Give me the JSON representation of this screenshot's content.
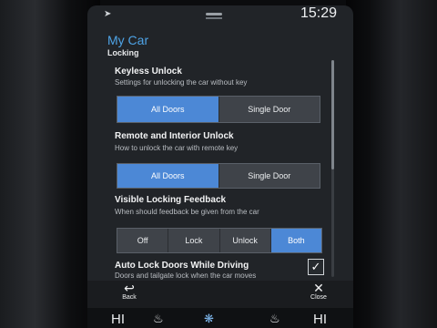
{
  "status": {
    "time": "15:29"
  },
  "header": {
    "title": "My Car",
    "subtitle": "Locking"
  },
  "sections": [
    {
      "title": "Keyless Unlock",
      "description": "Settings for unlocking the car without key",
      "options": [
        "All Doors",
        "Single Door"
      ],
      "selected": "All Doors"
    },
    {
      "title": "Remote and Interior Unlock",
      "description": "How to unlock the car with remote key",
      "options": [
        "All Doors",
        "Single Door"
      ],
      "selected": "All Doors"
    },
    {
      "title": "Visible Locking Feedback",
      "description": "When should feedback be given from the car",
      "options": [
        "Off",
        "Lock",
        "Unlock",
        "Both"
      ],
      "selected": "Both"
    },
    {
      "title": "Auto Lock Doors While Driving",
      "description": "Doors and tailgate lock when the car moves",
      "checked": true
    }
  ],
  "bottom": {
    "back_label": "Back",
    "close_label": "Close"
  },
  "climate": {
    "left_temp": "HI",
    "right_temp": "HI"
  },
  "colors": {
    "accent": "#4ea3e6",
    "selected": "#4c88d6"
  },
  "icons": [
    "nav-arrow-icon",
    "back-arrow-icon",
    "close-icon",
    "seat-heat-icon",
    "fan-icon",
    "checkmark-icon"
  ]
}
